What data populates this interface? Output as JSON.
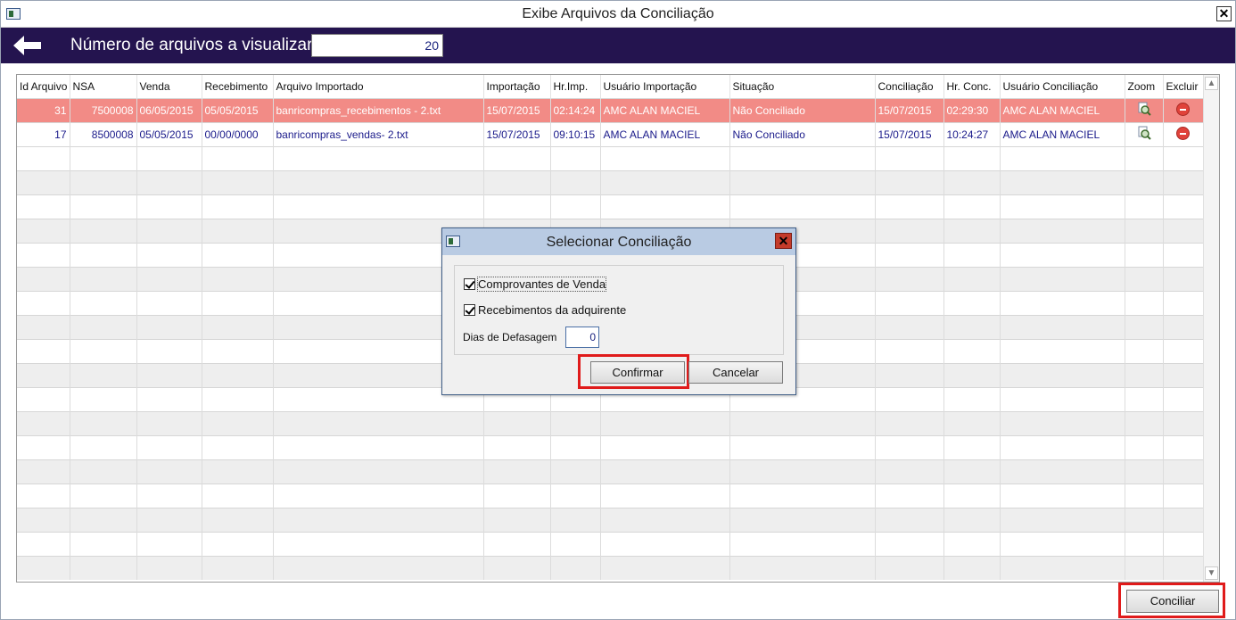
{
  "window": {
    "title": "Exibe Arquivos da Conciliação",
    "close_label": "✕"
  },
  "toolbar": {
    "label": "Número de arquivos a visualizar",
    "count_value": "20"
  },
  "grid": {
    "columns": [
      "Id Arquivo",
      "NSA",
      "Venda",
      "Recebimento",
      "Arquivo Importado",
      "Importação",
      "Hr.Imp.",
      "Usuário Importação",
      "Situação",
      "Conciliação",
      "Hr. Conc.",
      "Usuário Conciliação",
      "Zoom",
      "Excluir"
    ],
    "rows": [
      {
        "id": "31",
        "nsa": "7500008",
        "venda": "06/05/2015",
        "recebimento": "05/05/2015",
        "arquivo": "banricompras_recebimentos - 2.txt",
        "importacao": "15/07/2015",
        "hr_imp": "02:14:24",
        "usuario_imp": "AMC ALAN MACIEL",
        "situacao": "Não Conciliado",
        "conciliacao": "15/07/2015",
        "hr_conc": "02:29:30",
        "usuario_conc": "AMC ALAN MACIEL",
        "selected": true
      },
      {
        "id": "17",
        "nsa": "8500008",
        "venda": "05/05/2015",
        "recebimento": "00/00/0000",
        "arquivo": "banricompras_vendas- 2.txt",
        "importacao": "15/07/2015",
        "hr_imp": "09:10:15",
        "usuario_imp": "AMC ALAN MACIEL",
        "situacao": "Não Conciliado",
        "conciliacao": "15/07/2015",
        "hr_conc": "10:24:27",
        "usuario_conc": "AMC ALAN MACIEL",
        "selected": false
      }
    ],
    "empty_rows": 18,
    "selected_row_color": "#f28b86"
  },
  "footer": {
    "conciliar_label": "Conciliar"
  },
  "dialog": {
    "title": "Selecionar Conciliação",
    "checkbox_vendas": "Comprovantes de Venda",
    "checkbox_recebimentos": "Recebimentos da adquirente",
    "dias_label": "Dias de Defasagem",
    "dias_value": "0",
    "confirmar_label": "Confirmar",
    "cancelar_label": "Cancelar"
  },
  "colors": {
    "toolbar_bg": "#24144f",
    "highlight": "#e01b1b",
    "dialog_title_bg": "#b9cbe3"
  }
}
